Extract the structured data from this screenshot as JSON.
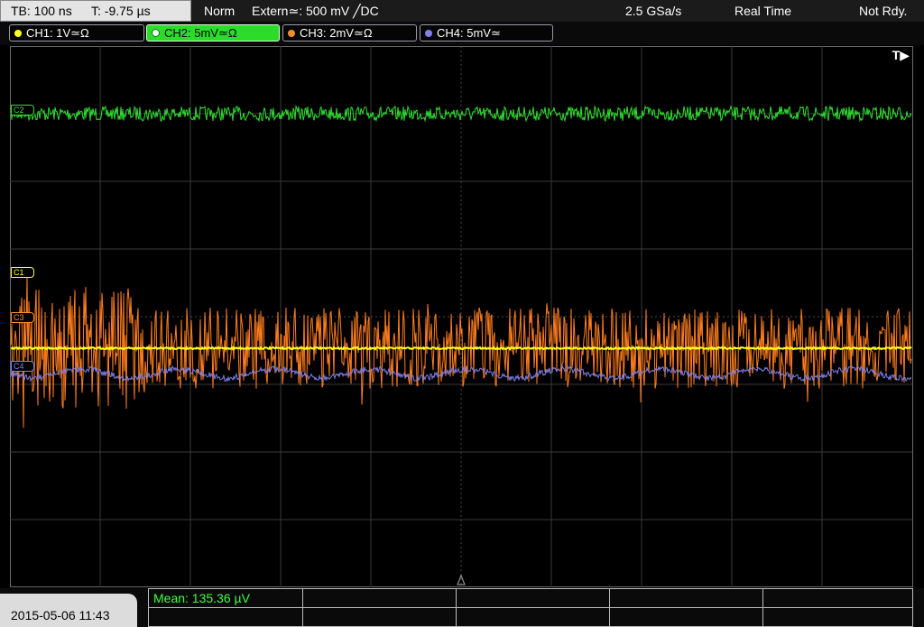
{
  "top": {
    "timebase": "TB: 100 ns",
    "trigger_time": "T: -9.75 µs",
    "mode": "Norm",
    "trigger": "Extern≃: 500 mV ╱DC",
    "sample_rate": "2.5 GSa/s",
    "acq_mode": "Real Time",
    "status": "Not Rdy."
  },
  "channels": [
    {
      "label": "CH1: 1V≃Ω",
      "color": "#ffff1e",
      "marker": "C1"
    },
    {
      "label": "CH2: 5mV≃Ω",
      "color": "#2ee02e",
      "marker": "C2"
    },
    {
      "label": "CH3: 2mV≃Ω",
      "color": "#ff8c28",
      "marker": "C3"
    },
    {
      "label": "CH4: 5mV≃",
      "color": "#8080f0",
      "marker": "C4"
    }
  ],
  "trigger_marker": "T▶",
  "bottom": {
    "datetime": "2015-05-06 11:43",
    "measurement": "Mean: 135.36 µV"
  }
}
